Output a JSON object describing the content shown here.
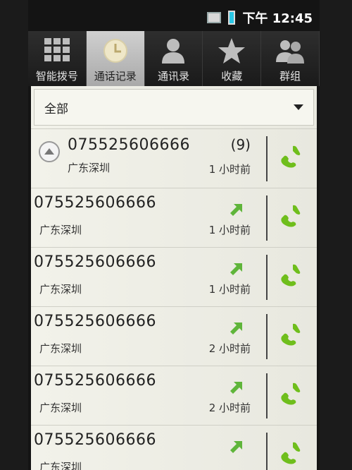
{
  "status": {
    "time": "下午 12:45"
  },
  "tabs": [
    {
      "label": "智能拨号",
      "icon": "keypad-icon"
    },
    {
      "label": "通话记录",
      "icon": "clock-icon"
    },
    {
      "label": "通讯录",
      "icon": "person-icon"
    },
    {
      "label": "收藏",
      "icon": "star-icon"
    },
    {
      "label": "群组",
      "icon": "group-icon"
    }
  ],
  "filter": {
    "label": "全部"
  },
  "calls": [
    {
      "number": "075525606666",
      "location": "广东深圳",
      "count": "(9)",
      "time": "1 小时前"
    },
    {
      "number": "075525606666",
      "location": "广东深圳",
      "time": "1 小时前",
      "type": "outgoing"
    },
    {
      "number": "075525606666",
      "location": "广东深圳",
      "time": "1 小时前",
      "type": "outgoing"
    },
    {
      "number": "075525606666",
      "location": "广东深圳",
      "time": "2 小时前",
      "type": "outgoing"
    },
    {
      "number": "075525606666",
      "location": "广东深圳",
      "time": "2 小时前",
      "type": "outgoing"
    },
    {
      "number": "075525606666",
      "location": "广东深圳",
      "time": "",
      "type": "outgoing"
    }
  ],
  "colors": {
    "call_green": "#6fbe1c",
    "accent_active_tab": "#bfbfbf"
  }
}
